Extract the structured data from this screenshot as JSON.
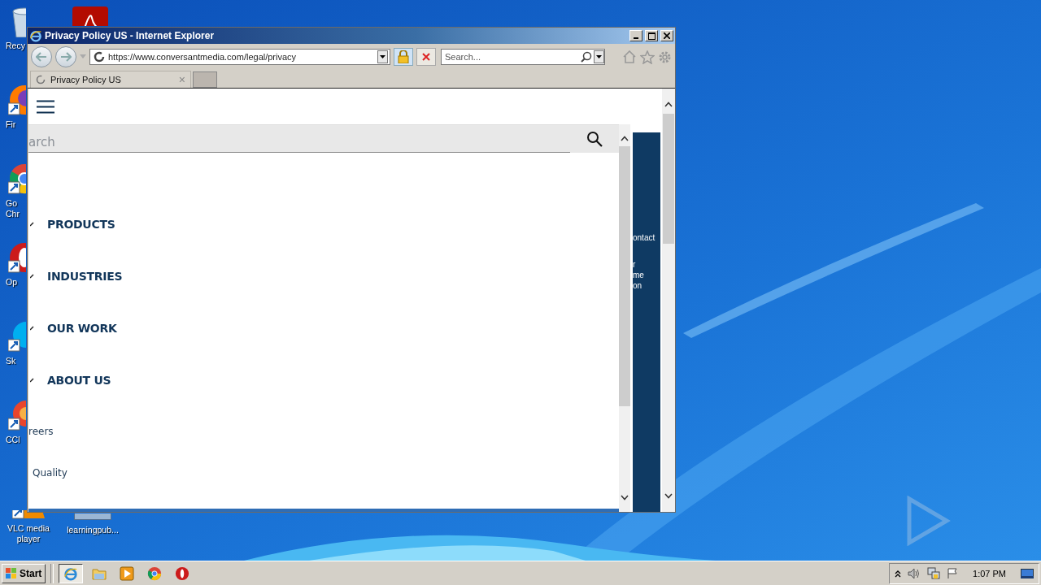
{
  "desktop": {
    "columns": [
      {
        "icons": [
          {
            "kind": "recycle",
            "label": "Recy"
          },
          {
            "kind": "firefox",
            "label": "Fir"
          },
          {
            "kind": "chrome",
            "label": "Go Chr"
          },
          {
            "kind": "opera",
            "label": "Op"
          },
          {
            "kind": "skype",
            "label": "Sk"
          },
          {
            "kind": "ccleaner",
            "label": "CCl"
          },
          {
            "kind": "vlc",
            "label": "VLC media player"
          }
        ]
      },
      {
        "icons": [
          {
            "kind": "acrobat"
          },
          {
            "kind": "file",
            "label": "learningpub..."
          }
        ]
      }
    ]
  },
  "window": {
    "title": "Privacy Policy US - Internet Explorer",
    "address": {
      "url": "https://www.conversantmedia.com/legal/privacy"
    },
    "search": {
      "placeholder": "Search..."
    },
    "tabs": [
      {
        "title": "Privacy Policy US",
        "close": "×",
        "selected": true
      }
    ]
  },
  "page": {
    "search": {
      "placeholder": "arch"
    },
    "menu": [
      {
        "label": "PRODUCTS"
      },
      {
        "label": "INDUSTRIES"
      },
      {
        "label": "OUR WORK"
      },
      {
        "label": "ABOUT US"
      }
    ],
    "links": [
      "reers",
      "Quality"
    ],
    "side_panel": {
      "lines": [
        "ontact",
        "r",
        "me",
        "on"
      ]
    }
  },
  "taskbar": {
    "start": "Start",
    "apps": [
      {
        "kind": "ie",
        "selected": true
      },
      {
        "kind": "folder",
        "selected": false
      },
      {
        "kind": "media",
        "selected": false
      },
      {
        "kind": "chrome",
        "selected": false
      },
      {
        "kind": "opera",
        "selected": false
      }
    ],
    "clock": "1:07 PM"
  }
}
